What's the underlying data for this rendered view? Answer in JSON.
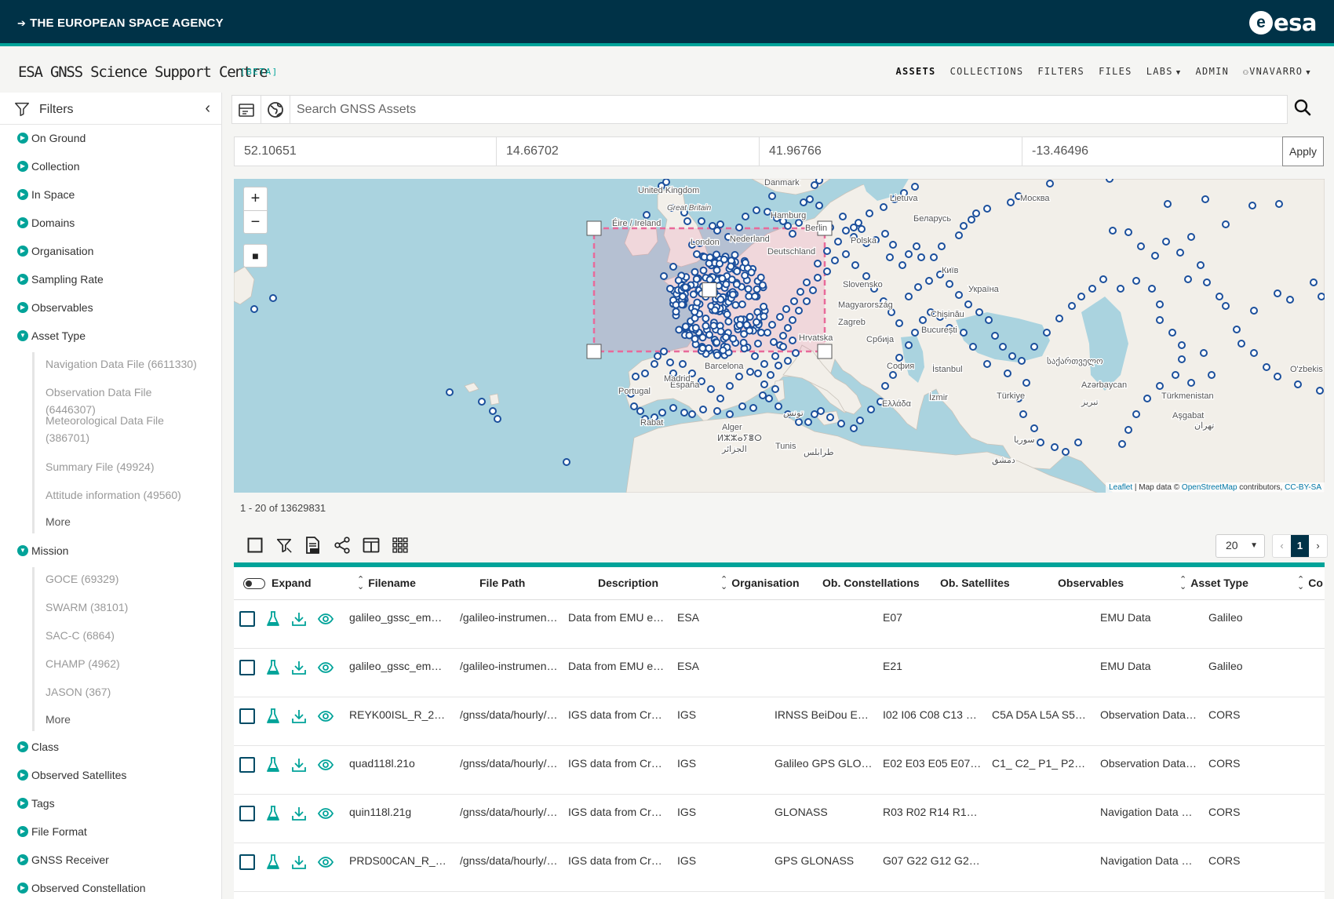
{
  "agency": "THE EUROPEAN SPACE AGENCY",
  "logo_word": "esa",
  "app": {
    "title": "ESA GNSS Science Support Centre",
    "badge": "[BETA]"
  },
  "nav": [
    {
      "label": "ASSETS",
      "active": true
    },
    {
      "label": "COLLECTIONS"
    },
    {
      "label": "FILTERS"
    },
    {
      "label": "FILES"
    },
    {
      "label": "LABS",
      "dropdown": true
    },
    {
      "label": "ADMIN"
    },
    {
      "label": "VNAVARRO",
      "dropdown": true,
      "user": true
    }
  ],
  "sidebar": {
    "title": "Filters",
    "facets": [
      {
        "label": "On Ground"
      },
      {
        "label": "Collection"
      },
      {
        "label": "In Space"
      },
      {
        "label": "Domains"
      },
      {
        "label": "Organisation"
      },
      {
        "label": "Sampling Rate"
      },
      {
        "label": "Observables"
      },
      {
        "label": "Asset Type",
        "expanded": true,
        "options": [
          "Navigation Data File (6611330)",
          "Observation Data File (6446307)",
          "Meteorological Data File (386701)",
          "Summary File (49924)",
          "Attitude information (49560)",
          "More"
        ]
      },
      {
        "label": "Mission",
        "expanded": true,
        "options": [
          "GOCE (69329)",
          "SWARM (38101)",
          "SAC-C (6864)",
          "CHAMP (4962)",
          "JASON (367)",
          "More"
        ]
      },
      {
        "label": "Class"
      },
      {
        "label": "Observed Satellites"
      },
      {
        "label": "Tags"
      },
      {
        "label": "File Format"
      },
      {
        "label": "GNSS Receiver"
      },
      {
        "label": "Observed Constellation"
      }
    ]
  },
  "search": {
    "placeholder": "Search GNSS Assets",
    "value": ""
  },
  "bbox": {
    "north": "52.10651",
    "east": "14.66702",
    "south": "41.96766",
    "west": "-13.46496",
    "apply_label": "Apply"
  },
  "map": {
    "zoom_in": "+",
    "zoom_out": "−",
    "draw": "■",
    "attribution_leaflet": "Leaflet",
    "attribution_text": " | Map data © ",
    "attribution_osm": "OpenStreetMap",
    "attribution_contrib": " contributors, ",
    "attribution_license": "CC-BY-SA",
    "labels": [
      "United Kingdom",
      "Great Britain",
      "Éire / Ireland",
      "London",
      "Nederland",
      "Danmark",
      "Hamburg",
      "Berlin",
      "Deutschland",
      "Polska",
      "Lietuva",
      "Беларусь",
      "Москва",
      "Київ",
      "Україна",
      "Slovensko",
      "Magyarország",
      "Chișinău",
      "Zagreb",
      "Hrvatska",
      "Србија",
      "București",
      "София",
      "İstanbul",
      "Türkiye",
      "İzmir",
      "Ελλάδα",
      "საქართველო",
      "Azərbaycan",
      "Türkmenistan",
      "Aşgabat",
      "O'zbekis",
      "Barcelona",
      "España",
      "Portugal",
      "Rabat",
      "Alger",
      "ⵍⵣⵣⴰⵢⴻⵔ",
      "الجزائر",
      "تونس",
      "طرابلس",
      "سوريا",
      "دمشق",
      "تبریز",
      "تهران",
      "Madrid",
      "Tunis"
    ]
  },
  "results": {
    "count_text": "1 - 20 of 13629831"
  },
  "pagination": {
    "page_size": "20",
    "prev": "‹",
    "current": "1",
    "next": "›"
  },
  "table": {
    "columns": [
      "Expand",
      "Filename",
      "File Path",
      "Description",
      "Organisation",
      "Ob. Constellations",
      "Ob. Satellites",
      "Observables",
      "Asset Type",
      "Co"
    ],
    "rows": [
      {
        "filename": "galileo_gssc_em…",
        "path": "/galileo-instrumen…",
        "description": "Data from EMU e…",
        "org": "ESA",
        "constellations": "",
        "satellites": "E07",
        "observables": "",
        "asset_type": "EMU Data",
        "col9": "Galileo"
      },
      {
        "filename": "galileo_gssc_em…",
        "path": "/galileo-instrumen…",
        "description": "Data from EMU e…",
        "org": "ESA",
        "constellations": "",
        "satellites": "E21",
        "observables": "",
        "asset_type": "EMU Data",
        "col9": "Galileo"
      },
      {
        "filename": "REYK00ISL_R_2…",
        "path": "/gnss/data/hourly/…",
        "description": "IGS data from Cr…",
        "org": "IGS",
        "constellations": "IRNSS BeiDou E…",
        "satellites": "I02 I06 C08 C13 …",
        "observables": "C5A D5A L5A S5…",
        "asset_type": "Observation Data…",
        "col9": "CORS"
      },
      {
        "filename": "quad118l.21o",
        "path": "/gnss/data/hourly/…",
        "description": "IGS data from Cr…",
        "org": "IGS",
        "constellations": "Galileo GPS GLO…",
        "satellites": "E02 E03 E05 E07…",
        "observables": "C1_ C2_ P1_ P2…",
        "asset_type": "Observation Data…",
        "col9": "CORS"
      },
      {
        "filename": "quin118l.21g",
        "path": "/gnss/data/hourly/…",
        "description": "IGS data from Cr…",
        "org": "IGS",
        "constellations": "GLONASS",
        "satellites": "R03 R02 R14 R1…",
        "observables": "",
        "asset_type": "Navigation Data …",
        "col9": "CORS"
      },
      {
        "filename": "PRDS00CAN_R_…",
        "path": "/gnss/data/hourly/…",
        "description": "IGS data from Cr…",
        "org": "IGS",
        "constellations": "GPS GLONASS",
        "satellites": "G07 G22 G12 G2…",
        "observables": "",
        "asset_type": "Navigation Data …",
        "col9": "CORS"
      }
    ]
  },
  "colors": {
    "accent": "#00a399",
    "header_bg": "#003247",
    "marker": "#1b4f9c",
    "bbox": "#e86a9a",
    "sea": "#aad3df",
    "land": "#f2efe9"
  }
}
